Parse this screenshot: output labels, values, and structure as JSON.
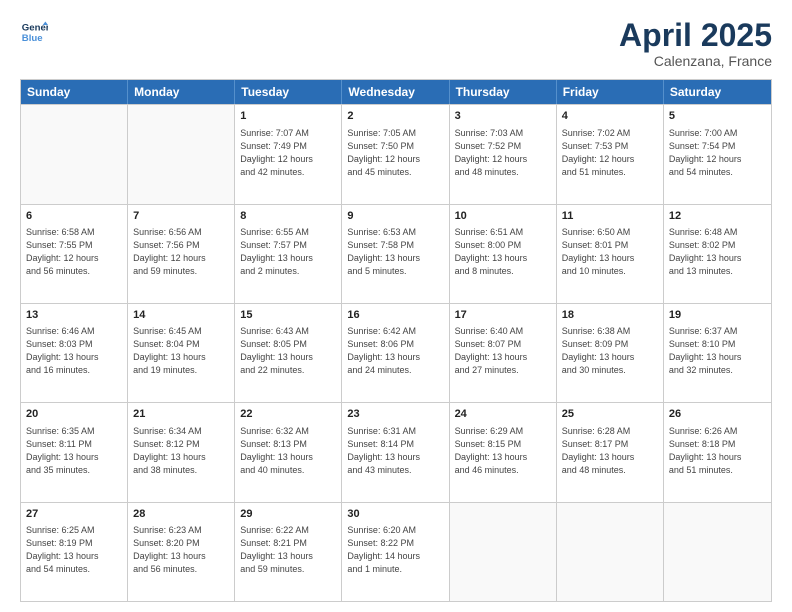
{
  "header": {
    "logo_line1": "General",
    "logo_line2": "Blue",
    "month": "April 2025",
    "location": "Calenzana, France"
  },
  "weekdays": [
    "Sunday",
    "Monday",
    "Tuesday",
    "Wednesday",
    "Thursday",
    "Friday",
    "Saturday"
  ],
  "weeks": [
    [
      {
        "day": "",
        "info": ""
      },
      {
        "day": "",
        "info": ""
      },
      {
        "day": "1",
        "info": "Sunrise: 7:07 AM\nSunset: 7:49 PM\nDaylight: 12 hours\nand 42 minutes."
      },
      {
        "day": "2",
        "info": "Sunrise: 7:05 AM\nSunset: 7:50 PM\nDaylight: 12 hours\nand 45 minutes."
      },
      {
        "day": "3",
        "info": "Sunrise: 7:03 AM\nSunset: 7:52 PM\nDaylight: 12 hours\nand 48 minutes."
      },
      {
        "day": "4",
        "info": "Sunrise: 7:02 AM\nSunset: 7:53 PM\nDaylight: 12 hours\nand 51 minutes."
      },
      {
        "day": "5",
        "info": "Sunrise: 7:00 AM\nSunset: 7:54 PM\nDaylight: 12 hours\nand 54 minutes."
      }
    ],
    [
      {
        "day": "6",
        "info": "Sunrise: 6:58 AM\nSunset: 7:55 PM\nDaylight: 12 hours\nand 56 minutes."
      },
      {
        "day": "7",
        "info": "Sunrise: 6:56 AM\nSunset: 7:56 PM\nDaylight: 12 hours\nand 59 minutes."
      },
      {
        "day": "8",
        "info": "Sunrise: 6:55 AM\nSunset: 7:57 PM\nDaylight: 13 hours\nand 2 minutes."
      },
      {
        "day": "9",
        "info": "Sunrise: 6:53 AM\nSunset: 7:58 PM\nDaylight: 13 hours\nand 5 minutes."
      },
      {
        "day": "10",
        "info": "Sunrise: 6:51 AM\nSunset: 8:00 PM\nDaylight: 13 hours\nand 8 minutes."
      },
      {
        "day": "11",
        "info": "Sunrise: 6:50 AM\nSunset: 8:01 PM\nDaylight: 13 hours\nand 10 minutes."
      },
      {
        "day": "12",
        "info": "Sunrise: 6:48 AM\nSunset: 8:02 PM\nDaylight: 13 hours\nand 13 minutes."
      }
    ],
    [
      {
        "day": "13",
        "info": "Sunrise: 6:46 AM\nSunset: 8:03 PM\nDaylight: 13 hours\nand 16 minutes."
      },
      {
        "day": "14",
        "info": "Sunrise: 6:45 AM\nSunset: 8:04 PM\nDaylight: 13 hours\nand 19 minutes."
      },
      {
        "day": "15",
        "info": "Sunrise: 6:43 AM\nSunset: 8:05 PM\nDaylight: 13 hours\nand 22 minutes."
      },
      {
        "day": "16",
        "info": "Sunrise: 6:42 AM\nSunset: 8:06 PM\nDaylight: 13 hours\nand 24 minutes."
      },
      {
        "day": "17",
        "info": "Sunrise: 6:40 AM\nSunset: 8:07 PM\nDaylight: 13 hours\nand 27 minutes."
      },
      {
        "day": "18",
        "info": "Sunrise: 6:38 AM\nSunset: 8:09 PM\nDaylight: 13 hours\nand 30 minutes."
      },
      {
        "day": "19",
        "info": "Sunrise: 6:37 AM\nSunset: 8:10 PM\nDaylight: 13 hours\nand 32 minutes."
      }
    ],
    [
      {
        "day": "20",
        "info": "Sunrise: 6:35 AM\nSunset: 8:11 PM\nDaylight: 13 hours\nand 35 minutes."
      },
      {
        "day": "21",
        "info": "Sunrise: 6:34 AM\nSunset: 8:12 PM\nDaylight: 13 hours\nand 38 minutes."
      },
      {
        "day": "22",
        "info": "Sunrise: 6:32 AM\nSunset: 8:13 PM\nDaylight: 13 hours\nand 40 minutes."
      },
      {
        "day": "23",
        "info": "Sunrise: 6:31 AM\nSunset: 8:14 PM\nDaylight: 13 hours\nand 43 minutes."
      },
      {
        "day": "24",
        "info": "Sunrise: 6:29 AM\nSunset: 8:15 PM\nDaylight: 13 hours\nand 46 minutes."
      },
      {
        "day": "25",
        "info": "Sunrise: 6:28 AM\nSunset: 8:17 PM\nDaylight: 13 hours\nand 48 minutes."
      },
      {
        "day": "26",
        "info": "Sunrise: 6:26 AM\nSunset: 8:18 PM\nDaylight: 13 hours\nand 51 minutes."
      }
    ],
    [
      {
        "day": "27",
        "info": "Sunrise: 6:25 AM\nSunset: 8:19 PM\nDaylight: 13 hours\nand 54 minutes."
      },
      {
        "day": "28",
        "info": "Sunrise: 6:23 AM\nSunset: 8:20 PM\nDaylight: 13 hours\nand 56 minutes."
      },
      {
        "day": "29",
        "info": "Sunrise: 6:22 AM\nSunset: 8:21 PM\nDaylight: 13 hours\nand 59 minutes."
      },
      {
        "day": "30",
        "info": "Sunrise: 6:20 AM\nSunset: 8:22 PM\nDaylight: 14 hours\nand 1 minute."
      },
      {
        "day": "",
        "info": ""
      },
      {
        "day": "",
        "info": ""
      },
      {
        "day": "",
        "info": ""
      }
    ]
  ]
}
